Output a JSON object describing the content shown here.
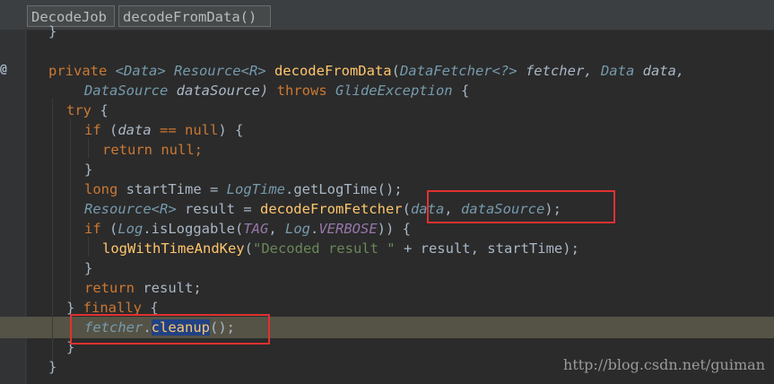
{
  "breadcrumb": {
    "class_name": "DecodeJob",
    "method_name": "decodeFromData()"
  },
  "gutter": {
    "annotation_marker": "@"
  },
  "code": {
    "l0_brace": "}",
    "l1_private": "private ",
    "l1_data_generic": "<Data> ",
    "l1_resource": "Resource",
    "l1_r_generic": "<R> ",
    "l1_method": "decodeFromData",
    "l1_open": "(",
    "l1_fetcher_type": "DataFetcher",
    "l1_wild": "<?>",
    "l1_fetcher_name": " fetcher, ",
    "l1_data_type": "Data",
    "l1_data_name": " data,",
    "l2_ds_type": "DataSource",
    "l2_ds_name": " dataSource) ",
    "l2_throws": "throws ",
    "l2_exc": "GlideException",
    "l2_brace": " {",
    "l3_try": "try",
    "l3_brace": " {",
    "l4_if": "if",
    "l4_rest_a": " (",
    "l4_data": "data",
    "l4_eq": " == ",
    "l4_null": "null",
    "l4_rest_b": ") {",
    "l5_return": "return null;",
    "l6_brace": "}",
    "l7_long": "long",
    "l7_rest": " startTime = ",
    "l7_logtime": "LogTime",
    "l7_call": ".getLogTime();",
    "l8_resource": "Resource",
    "l8_r": "<R>",
    "l8_rest": " result = ",
    "l8_fn": "decodeFromFetcher",
    "l8_args_open": "(",
    "l8_arg1": "data",
    "l8_comma": ", ",
    "l8_arg2": "dataSource",
    "l8_close": ");",
    "l9_if": "if",
    "l9_open": " (",
    "l9_log": "Log",
    "l9_call": ".isLoggable(",
    "l9_tag": "TAG",
    "l9_comma": ", ",
    "l9_log2": "Log",
    "l9_dot": ".",
    "l9_verbose": "VERBOSE",
    "l9_close": ")) {",
    "l10_fn": "logWithTimeAndKey",
    "l10_open": "(",
    "l10_str": "\"Decoded result \"",
    "l10_rest": " + result, startTime);",
    "l11_brace": "}",
    "l12_return": "return",
    "l12_rest": " result;",
    "l13_brace": "} ",
    "l13_finally": "finally",
    "l13_brace2": " {",
    "l14_fetcher": "fetcher",
    "l14_dot": ".",
    "l14_cleanup": "cleanup",
    "l14_rest": "();",
    "l15_brace": "}",
    "l16_brace": "}"
  },
  "watermark": "http://blog.csdn.net/guiman",
  "colors": {
    "keyword": "#cc7832",
    "method": "#ffc66d",
    "annotation_box": "#e03131"
  }
}
